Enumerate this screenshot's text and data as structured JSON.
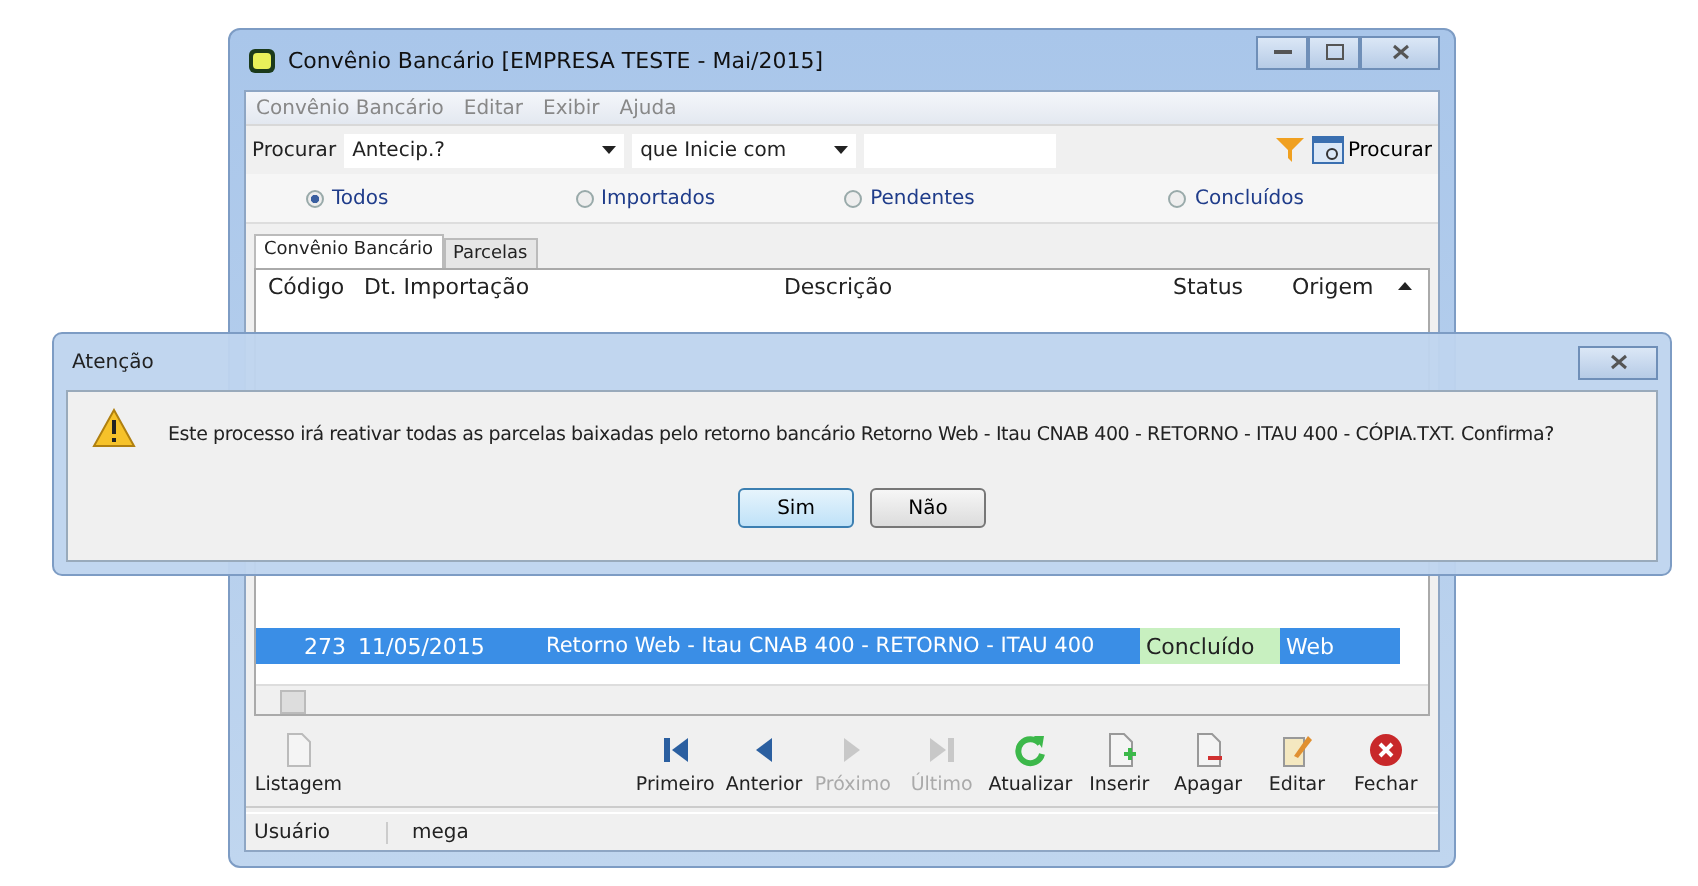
{
  "window": {
    "title": "Convênio Bancário [EMPRESA TESTE - Mai/2015]"
  },
  "menu": [
    {
      "label": "Convênio Bancário"
    },
    {
      "label": "Editar"
    },
    {
      "label": "Exibir"
    },
    {
      "label": "Ajuda"
    }
  ],
  "search": {
    "label": "Procurar",
    "field": "Antecip.?",
    "operator": "que Inicie com",
    "button": "Procurar"
  },
  "filters": [
    {
      "label": "Todos",
      "selected": true
    },
    {
      "label": "Importados",
      "selected": false
    },
    {
      "label": "Pendentes",
      "selected": false
    },
    {
      "label": "Concluídos",
      "selected": false
    }
  ],
  "tabs": [
    {
      "label": "Convênio Bancário",
      "selected": true
    },
    {
      "label": "Parcelas",
      "selected": false
    }
  ],
  "table": {
    "columns": [
      "Código",
      "Dt. Importação",
      "Descrição",
      "Status",
      "Origem"
    ],
    "rows": [
      {
        "cells": [
          "273",
          "11/05/2015",
          "Retorno Web - Itau CNAB 400 - RETORNO - ITAU 400",
          "Concluído",
          "Web"
        ],
        "selected": true,
        "color": "#c8f0c0"
      }
    ]
  },
  "toolbar": [
    {
      "kind": "list",
      "label": "Listagem",
      "disabled": false
    },
    {
      "kind": "first",
      "label": "Primeiro",
      "disabled": false
    },
    {
      "kind": "prev",
      "label": "Anterior",
      "disabled": false
    },
    {
      "kind": "next",
      "label": "Próximo",
      "disabled": true
    },
    {
      "kind": "last",
      "label": "Último",
      "disabled": true
    },
    {
      "kind": "refresh",
      "label": "Atualizar",
      "disabled": false
    },
    {
      "kind": "insert",
      "label": "Inserir",
      "disabled": false
    },
    {
      "kind": "delete",
      "label": "Apagar",
      "disabled": false
    },
    {
      "kind": "edit",
      "label": "Editar",
      "disabled": false
    },
    {
      "kind": "close",
      "label": "Fechar",
      "disabled": false
    }
  ],
  "status_bar": [
    {
      "text": "Usuário"
    },
    {
      "text": "mega"
    }
  ],
  "dialog": {
    "title": "Atenção",
    "message": "Este processo irá reativar todas as parcelas baixadas pelo retorno bancário Retorno Web - Itau CNAB 400 - RETORNO - ITAU 400 - CÓPIA.TXT. Confirma?",
    "buttons": [
      {
        "label": "Sim",
        "selected": true
      },
      {
        "label": "Não",
        "selected": false
      }
    ]
  }
}
